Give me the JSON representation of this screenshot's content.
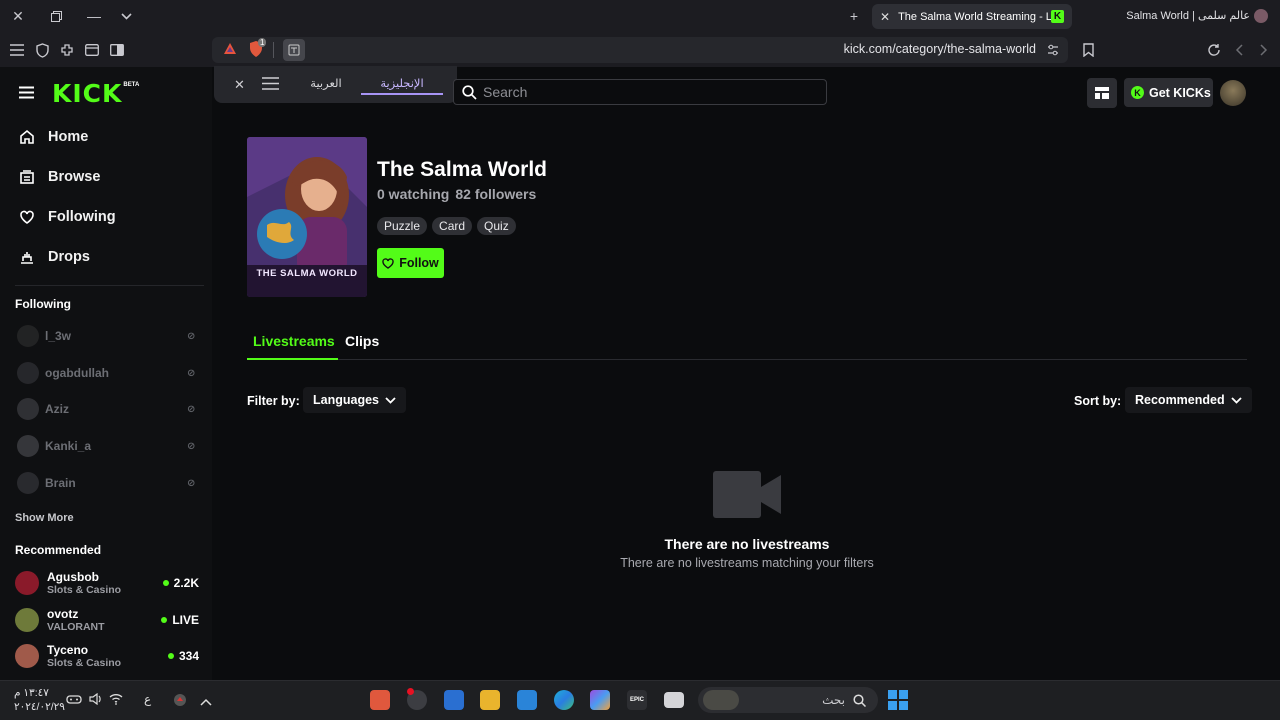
{
  "browser": {
    "tab_title": "The Salma World Streaming - Liv",
    "window_title": "Salma World | عالم سلمى",
    "url": "kick.com/category/the-salma-world",
    "shield_count": "1"
  },
  "translate_popup": {
    "lang_from": "العربية",
    "lang_to": "الإنجليزية"
  },
  "header": {
    "logo": "KICK",
    "logo_badge": "BETA",
    "search_placeholder": "Search",
    "get_kicks": "Get KICKs"
  },
  "sidebar": {
    "nav": [
      {
        "label": "Home",
        "icon": "home-icon"
      },
      {
        "label": "Browse",
        "icon": "browse-icon"
      },
      {
        "label": "Following",
        "icon": "heart-icon"
      },
      {
        "label": "Drops",
        "icon": "drops-icon"
      }
    ],
    "following_heading": "Following",
    "following": [
      "l_3w",
      "ogabdullah",
      "Aziz",
      "Kanki_a",
      "Brain"
    ],
    "show_more": "Show More",
    "recommended_heading": "Recommended",
    "recommended": [
      {
        "name": "Agusbob",
        "category": "Slots & Casino",
        "viewers": "2.2K"
      },
      {
        "name": "ovotz",
        "category": "VALORANT",
        "viewers": "LIVE"
      },
      {
        "name": "Tyceno",
        "category": "Slots & Casino",
        "viewers": "334"
      }
    ]
  },
  "category": {
    "cover_text": "THE SALMA WORLD",
    "title": "The Salma World",
    "watching": "0 watching",
    "followers": "82 followers",
    "tags": [
      "Puzzle",
      "Card",
      "Quiz"
    ],
    "follow_label": "Follow"
  },
  "tabs": {
    "livestreams": "Livestreams",
    "clips": "Clips"
  },
  "filters": {
    "filter_label": "Filter by:",
    "filter_value": "Languages",
    "sort_label": "Sort by:",
    "sort_value": "Recommended"
  },
  "empty_state": {
    "title": "There are no livestreams",
    "subtitle": "There are no livestreams matching your filters"
  },
  "taskbar": {
    "search_label": "بحث",
    "time": "١٣:٤٧ م",
    "date": "٢٠٢٤/٠٢/٢٩",
    "lang": "ع"
  },
  "colors": {
    "accent": "#53fc18",
    "background": "#0b0c0e",
    "sidebar": "#0f1012"
  }
}
